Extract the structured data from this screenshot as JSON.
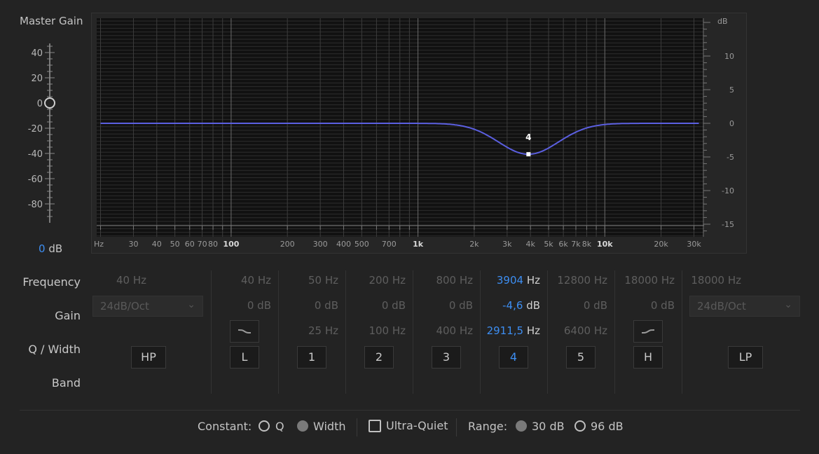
{
  "master_gain": {
    "title": "Master Gain",
    "ticks": [
      "40",
      "20",
      "0",
      "-20",
      "-40",
      "-60",
      "-80"
    ],
    "value": "0",
    "unit": "dB",
    "knob_value_db": 0
  },
  "graph": {
    "db_unit": "dB",
    "db_ticks": [
      "10",
      "5",
      "0",
      "-5",
      "-10",
      "-15"
    ],
    "freq_unit": "Hz",
    "freq_ticks": [
      "30",
      "40",
      "50",
      "60",
      "70",
      "80",
      "100",
      "200",
      "300",
      "400",
      "500",
      "700",
      "1k",
      "2k",
      "3k",
      "4k",
      "5k",
      "6k",
      "7k",
      "8k",
      "10k",
      "20k",
      "30k"
    ],
    "band_marker": {
      "label": "4",
      "frequency_hz": 3904,
      "gain_db": -4.6
    },
    "colors": {
      "curve": "#5b5fe0",
      "background": "#111111"
    }
  },
  "rows": {
    "frequency": "Frequency",
    "gain": "Gain",
    "q_width": "Q / Width",
    "band": "Band"
  },
  "bands": [
    {
      "id": "HP",
      "freq": "40 Hz",
      "slope": "24dB/Oct"
    },
    {
      "id": "L",
      "freq": "40 Hz",
      "gain": "0 dB",
      "shape_icon": "low-shelf-icon"
    },
    {
      "id": "1",
      "freq": "50 Hz",
      "gain": "0 dB",
      "q": "25 Hz"
    },
    {
      "id": "2",
      "freq": "200 Hz",
      "gain": "0 dB",
      "q": "100 Hz"
    },
    {
      "id": "3",
      "freq": "800 Hz",
      "gain": "0 dB",
      "q": "400 Hz"
    },
    {
      "id": "4",
      "freq_num": "3904",
      "freq_unit": "Hz",
      "gain_num": "-4,6",
      "gain_unit": "dB",
      "q_num": "2911,5",
      "q_unit": "Hz",
      "active": true
    },
    {
      "id": "5",
      "freq": "12800 Hz",
      "gain": "0 dB",
      "q": "6400 Hz"
    },
    {
      "id": "H",
      "freq": "18000 Hz",
      "gain": "0 dB",
      "shape_icon": "high-shelf-icon"
    },
    {
      "id": "LP",
      "freq": "18000 Hz",
      "slope": "24dB/Oct"
    }
  ],
  "bottom": {
    "constant_label": "Constant:",
    "q_label": "Q",
    "width_label": "Width",
    "constant_selected": "Width",
    "ultra_quiet_label": "Ultra-Quiet",
    "ultra_quiet_checked": false,
    "range_label": "Range:",
    "range_30": "30 dB",
    "range_96": "96 dB",
    "range_selected": "30 dB"
  }
}
